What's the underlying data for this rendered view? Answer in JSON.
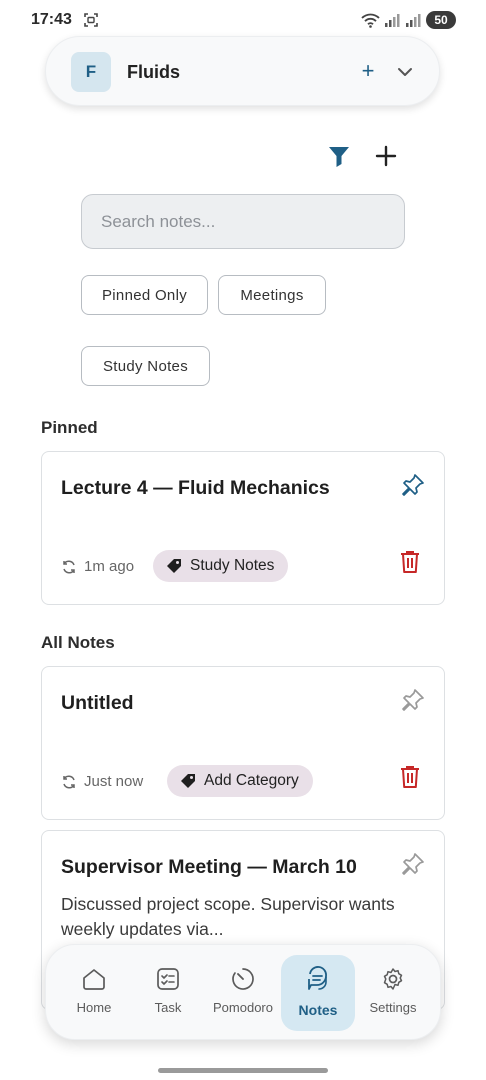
{
  "status_bar": {
    "time": "17:43",
    "battery": "50",
    "icons": [
      "screen-record-icon",
      "wifi-icon",
      "signal-icon",
      "signal-icon",
      "battery-icon"
    ]
  },
  "workspace": {
    "avatar_letter": "F",
    "name": "Fluids",
    "add_symbol": "+"
  },
  "toolbar": {
    "filter_icon": "filter-icon",
    "add_icon": "plus-icon"
  },
  "search": {
    "placeholder": "Search notes...",
    "value": ""
  },
  "filters": [
    "Pinned Only",
    "Meetings",
    "Study Notes"
  ],
  "sections": {
    "pinned": "Pinned",
    "all": "All Notes"
  },
  "notes": {
    "pinned": [
      {
        "title": "Lecture 4 — Fluid Mechanics",
        "updated": "1m ago",
        "category": "Study Notes",
        "pinned": true
      }
    ],
    "all": [
      {
        "title": "Untitled",
        "updated": "Just now",
        "category": "Add Category",
        "pinned": false
      },
      {
        "title": "Supervisor Meeting — March 10",
        "preview": "Discussed project scope. Supervisor wants weekly updates via...",
        "pinned": false
      }
    ]
  },
  "nav": {
    "items": [
      {
        "label": "Home",
        "icon": "home-icon"
      },
      {
        "label": "Task",
        "icon": "checklist-icon"
      },
      {
        "label": "Pomodoro",
        "icon": "timer-icon"
      },
      {
        "label": "Notes",
        "icon": "notes-icon"
      },
      {
        "label": "Settings",
        "icon": "gear-icon"
      }
    ],
    "active": "Notes"
  },
  "colors": {
    "accent": "#1f5f86",
    "accent_light": "#d5e8f2",
    "delete": "#c62828",
    "tag_bg": "#e9e0e8",
    "pin_active": "#1f5f86",
    "pin_inactive": "#9a9a9a"
  }
}
